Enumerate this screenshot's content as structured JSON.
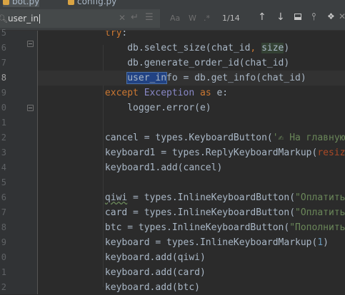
{
  "tabs": [
    {
      "label": "bot.py",
      "active": true
    },
    {
      "label": "config.py",
      "active": false
    }
  ],
  "find": {
    "query": "user_in",
    "icon": "search-icon",
    "options": [
      "Aa",
      "W",
      ".*"
    ],
    "match_count": "1/14",
    "icons": [
      "arrow-up-icon",
      "arrow-down-icon",
      "select-all-occurrences-icon",
      "filter-icon"
    ]
  },
  "gutter": {
    "line_numbers": [
      "5",
      "6",
      "7",
      "8",
      "9",
      "0",
      "1",
      "2",
      "3",
      "4",
      "5",
      "6",
      "7",
      "8",
      "9",
      "0",
      "1",
      "2",
      "3"
    ],
    "current_line": "8"
  },
  "code": {
    "l01": {
      "k": "try",
      "p": ":"
    },
    "l02": {
      "a": "db.select_size(chat_id",
      "b": ", ",
      "c": "size",
      "d": ")"
    },
    "l03": {
      "a": "db.generate_order_id(chat_id)"
    },
    "l04": {
      "m": "user_in",
      "a": "fo = db.get_info(chat_id)"
    },
    "l05": {
      "k": "except",
      "s": " ",
      "c": "Exception",
      "s2": " ",
      "k2": "as",
      "a": " e:"
    },
    "l06": {
      "a": "logger.error(e)"
    },
    "l08": {
      "a": "cancel = types.KeyboardButton(",
      "s": "'✍ На главную'",
      "b": ")"
    },
    "l09": {
      "a": "keyboard1 = types.ReplyKeyboardMarkup(",
      "r": "resize_k"
    },
    "l10": {
      "a": "keyboard1.add(cancel)"
    },
    "l12": {
      "v": "qiwi",
      "a": " = types.InlineKeyboardButton(",
      "s": "\"Оплатить с "
    },
    "l13": {
      "a": "card = types.InlineKeyboardButton(",
      "s": "\"Оплатить с "
    },
    "l14": {
      "a": "btc = types.InlineKeyboardButton(",
      "s": "\"Пополнить Би"
    },
    "l15": {
      "a": "keyboard = types.InlineKeyboardMarkup(",
      "n": "1",
      "b": ")"
    },
    "l16": {
      "a": "keyboard.add(qiwi)"
    },
    "l17": {
      "a": "keyboard.add(card)"
    },
    "l18": {
      "a": "keyboard.add(btc)"
    }
  },
  "colors": {
    "background": "#2b2b2b",
    "keyword": "#cc7832",
    "string": "#6a8759",
    "number": "#6897bb",
    "builtin_class": "#8888c6",
    "search_match": "#214283"
  }
}
